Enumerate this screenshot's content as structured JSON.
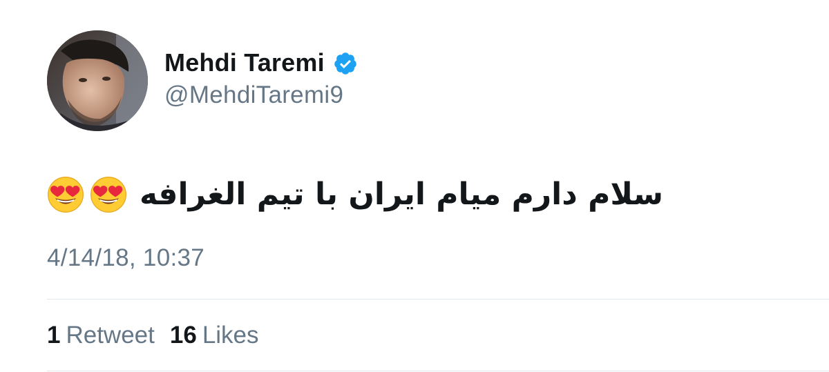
{
  "author": {
    "display_name": "Mehdi Taremi",
    "username": "@MehdiTaremi9",
    "verified": true
  },
  "tweet": {
    "text": "سلام دارم میام ایران با تیم الغرافه",
    "emojis": [
      "smiling-face-with-heart-eyes",
      "smiling-face-with-heart-eyes"
    ],
    "timestamp": "4/14/18, 10:37"
  },
  "stats": {
    "retweets_count": "1",
    "retweets_label": "Retweet",
    "likes_count": "16",
    "likes_label": "Likes"
  },
  "colors": {
    "primary_text": "#14171a",
    "secondary_text": "#657786",
    "verified_blue": "#1da1f2",
    "divider": "#e1e8ed"
  }
}
